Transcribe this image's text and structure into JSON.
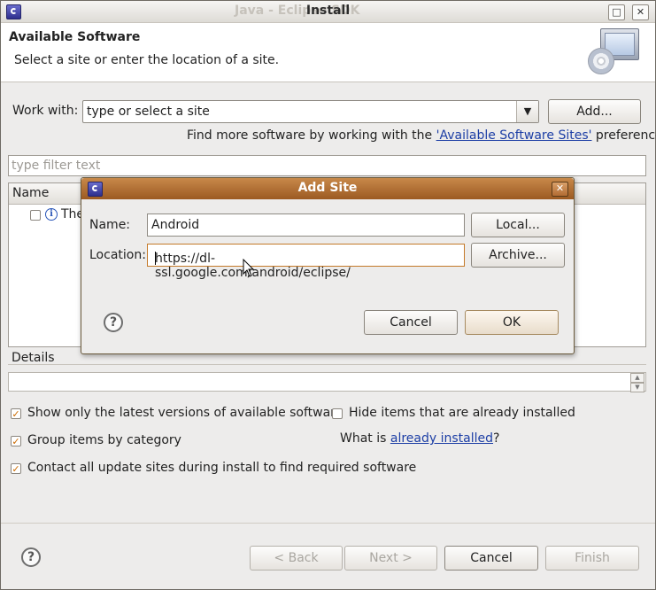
{
  "window": {
    "title": "Install",
    "ghost_title": "Java - Eclipse SDK",
    "maximize_icon": "maximize-icon",
    "close_icon": "close-icon"
  },
  "header": {
    "title": "Available Software",
    "subtitle": "Select a site or enter the location of a site."
  },
  "work_with": {
    "label": "Work with:",
    "value": "type or select a site",
    "add_button": "Add...",
    "find_more_prefix": "Find more software by working with the ",
    "find_more_link": "'Available Software Sites'",
    "find_more_suffix": " preferences."
  },
  "filter": {
    "placeholder": "type filter text"
  },
  "tree": {
    "column_name": "Name",
    "row_text": "The"
  },
  "details": {
    "label": "Details"
  },
  "options": {
    "show_latest": {
      "label": "Show only the latest versions of available software",
      "checked": true
    },
    "hide_installed": {
      "label": "Hide items that are already installed",
      "checked": false
    },
    "group_by_category": {
      "label": "Group items by category",
      "checked": true
    },
    "contact_sites": {
      "label": "Contact all update sites during install to find required software",
      "checked": true
    },
    "what_is_prefix": "What is ",
    "what_is_link": "already installed",
    "what_is_suffix": "?"
  },
  "footer": {
    "back": "< Back",
    "next": "Next >",
    "cancel": "Cancel",
    "finish": "Finish"
  },
  "add_site_dialog": {
    "title": "Add Site",
    "name_label": "Name:",
    "name_value": "Android",
    "location_label": "Location:",
    "location_value": "https://dl-ssl.google.com/android/eclipse/",
    "local_button": "Local...",
    "archive_button": "Archive...",
    "cancel_button": "Cancel",
    "ok_button": "OK"
  }
}
